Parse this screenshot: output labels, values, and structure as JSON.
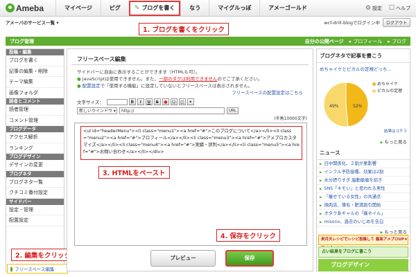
{
  "header": {
    "logo_text": "Ameba",
    "nav": [
      {
        "label": "マイページ"
      },
      {
        "label": "ピグ"
      },
      {
        "label": "ブログを書く"
      },
      {
        "label": "なう"
      },
      {
        "label": "マイグルっぽ"
      },
      {
        "label": "アメーゴールド"
      }
    ],
    "settings_label": "設定",
    "help_label": "ヘルプ"
  },
  "subbar": {
    "services_label": "アメーバのサービス一覧 ▾",
    "login_status": "wcf-drill-blogでログイン中",
    "logout_label": "ログアウト"
  },
  "annotations": {
    "step1": "1. ブログを書くをクリック",
    "step2": "2. 編集をクリック",
    "step3": "3. HTMLをペースト",
    "step4": "4. 保存をクリック"
  },
  "headband": {
    "title": "ブログ管理",
    "my_page": "自分の公開ページ",
    "profile": "▸ プロフィール",
    "blog": "▸ ブログ"
  },
  "sidebar": {
    "sections": [
      {
        "title": "投稿・編集",
        "items": [
          "ブログを書く",
          "記事の編集・削除",
          "テーマ編集",
          "画像フォルダ"
        ]
      },
      {
        "title": "読者とコメント",
        "items": [
          "読者管理",
          "コメント管理"
        ]
      },
      {
        "title": "ブログデータ",
        "items": [
          "アクセス解析",
          "ランキング"
        ]
      },
      {
        "title": "ブログデザイン",
        "items": [
          "デザインの変更"
        ]
      },
      {
        "title": "ブログネタ",
        "items": [
          "ブログネタ一覧",
          "クチコミ番付設定"
        ]
      },
      {
        "title": "サイドバー",
        "items": [
          "設定・管理",
          "配置設定"
        ]
      }
    ],
    "active_item": "フリースペース編集"
  },
  "main": {
    "title": "フリースペース編集",
    "desc_line1": "サイドバーに自由に表示することができます（HTMLも可）。",
    "desc_line2a": "JavaScriptは使用できません。また、",
    "desc_line2b": "一部のタグは利用できません",
    "desc_line2c": "のでご了承ください。",
    "desc_line3a": "配置設定",
    "desc_line3b": "で「使用する機能」に設定していないとフリースペースは表示されません。",
    "layout_link": "フリースペースの配置設定はこちら",
    "font_size_label": "文字サイズ：",
    "font_size_value": "",
    "toolbar_buttons": [
      "B",
      "I",
      "U",
      "S",
      "●",
      "☺",
      "◫",
      "✦"
    ],
    "window_select": "新しいウインドウ ▾",
    "url_value": "http://",
    "insert_label": "URL",
    "counter": "(半角10000文字)",
    "html_content": "<ul id=\"headerMenu\"><li class=\"menu1\"><a href=\"#\">このブログについて</a></li><li class=\"menu2\"><a href=\"#\">プロフィール</a></li><li class=\"menu3\"><a href=\"#\">アメブロカスタマイズ</a></li><li class=\"menu4\"><a href=\"#\">実績・評判</a></li><li class=\"menu5\"><a href=\"#\">お問い合わせ</a></li></div>",
    "preview_label": "プレビュー",
    "save_label": "保存"
  },
  "rside": {
    "neta_title": "ブログネタで記事を書こう",
    "neta_link": "めちゃイケとピカルの定規どっち...",
    "pie_legend": [
      "めちゃイケ",
      "ピカルの定理"
    ],
    "pie_values": [
      49,
      52
    ],
    "pie_colors": [
      "#f2b81a",
      "#f8d86a"
    ],
    "pie_label_a": "49%",
    "pie_label_b": "52%",
    "result_link": "結果はコチラ",
    "more_label": "もっと見る",
    "news_title": "ニュース",
    "news": [
      "日中関係化、２割が悪影響",
      "インフル予防接種、効果は2割",
      "水分摂りすぎ 脳動脈瘤を招き",
      "SNS「キモい」と思われる男性",
      "「痩せている女性」の共通点",
      "焼肉店、薄毛・肥満割引開始",
      "オタク系ギャルの「痛ネイル」",
      "misono、過去のいじめを告白"
    ],
    "news_more": "もっと見る",
    "banner1": "来月天レシピでレシピ投稿して 最高アメブロUP★アメゴールドGET!",
    "banner2": "占い結果をブログに書こう",
    "banner3": "ブログデザイン"
  }
}
